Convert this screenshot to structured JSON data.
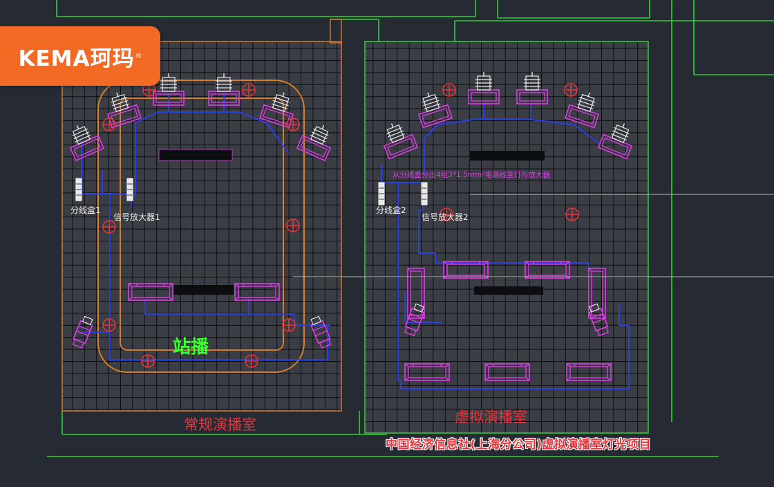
{
  "logo": {
    "text": "KEMA珂玛",
    "mark": "®"
  },
  "rooms": {
    "regular": {
      "title": "常规演播室",
      "zone_label": "站播",
      "junction_box": "分线盒1",
      "amplifier": "信号放大器1"
    },
    "virtual": {
      "title": "虚拟演播室",
      "junction_box": "分线盒2",
      "amplifier": "信号放大器2",
      "cable_note": "从分线盒分出4组3*1.5mm²电源线至灯与放大器"
    }
  },
  "caption": "中国经济信息社(上海分公司)虚拟演播室灯光项目",
  "colors": {
    "background": "#262b33",
    "wall_green": "#2fd23b",
    "orange": "#d67d2e",
    "magenta": "#e23be9",
    "blue_cable": "#2a3fe0",
    "red_text": "#e8343a",
    "green_text": "#3cff2c",
    "logo_orange": "#f36a24",
    "grid": "#0c0d10"
  },
  "icons": {
    "outlet": "circle-cross-icon",
    "fixture": "light-fixture-icon",
    "junction": "junction-box-icon"
  }
}
